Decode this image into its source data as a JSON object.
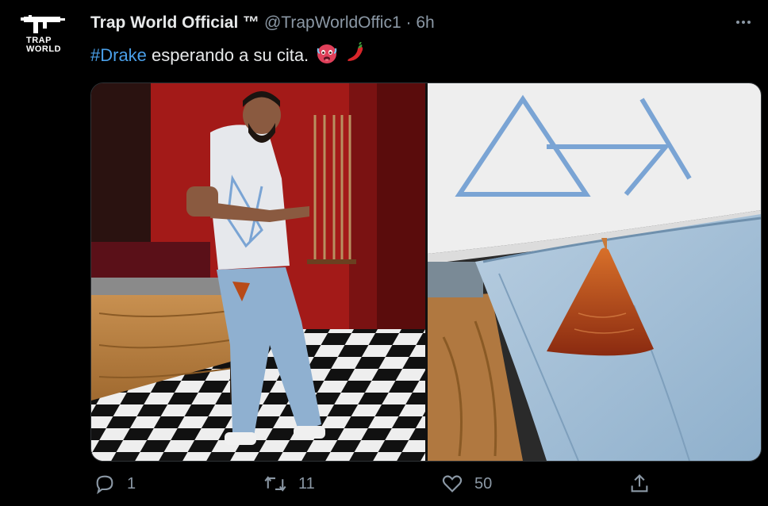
{
  "tweet": {
    "display_name": "Trap World Official ™",
    "handle": "@TrapWorldOffic1",
    "separator": "·",
    "time": "6h",
    "hashtag": "#Drake",
    "text": " esperando a su cita.",
    "emojis": [
      "hot-face-emoji",
      "chili-pepper-emoji"
    ]
  },
  "avatar": {
    "line1": "TRAP",
    "line2": "WORLD",
    "icon": "uzi-gun-logo"
  },
  "actions": {
    "reply_count": "1",
    "retweet_count": "11",
    "like_count": "50",
    "icons": [
      "reply-icon",
      "retweet-icon",
      "like-icon",
      "share-icon"
    ]
  },
  "colors": {
    "background": "#000000",
    "text": "#e7e9ea",
    "muted": "#8b98a5",
    "hashtag": "#4a9fe8"
  }
}
